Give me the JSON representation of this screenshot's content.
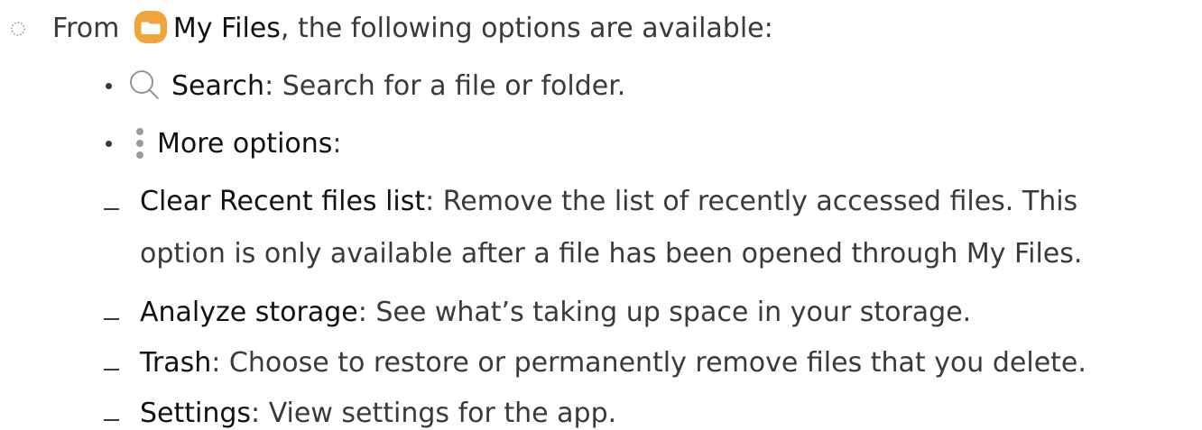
{
  "intro": {
    "prefix": "From",
    "app_name": "My Files",
    "suffix": ", the following options are available:",
    "app_icon": "my-files-folder-icon",
    "marker_icon": "dotted-circle-icon",
    "accent_color": "#f0a43a"
  },
  "options": [
    {
      "icon": "search-icon",
      "term": "Search",
      "description": ": Search for a file or folder."
    },
    {
      "icon": "more-options-icon",
      "term": "More options",
      "description": ":"
    }
  ],
  "more_options": [
    {
      "term": "Clear Recent files list",
      "description": ": Remove the list of recently accessed files. This",
      "continuation": "option is only available after a file has been opened through My Files."
    },
    {
      "term": "Analyze storage",
      "description": ": See what’s taking up space in your storage."
    },
    {
      "term": "Trash",
      "description": ": Choose to restore or permanently remove files that you delete."
    },
    {
      "term": "Settings",
      "description": ": View settings for the app."
    }
  ]
}
